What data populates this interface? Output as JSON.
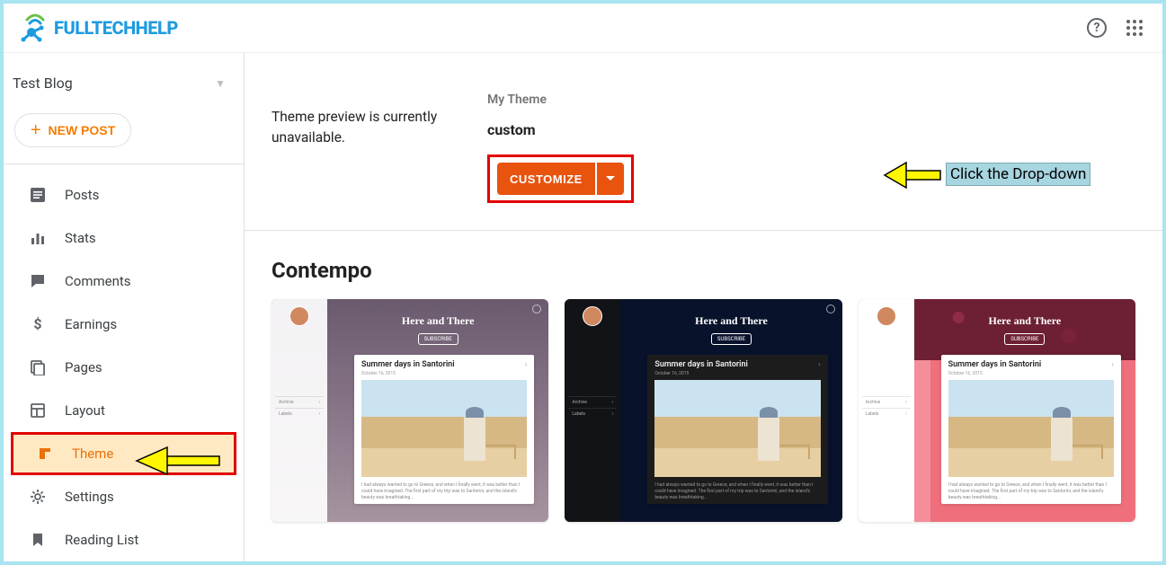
{
  "logo_text": "FULLTECHHELP",
  "blog_name": "Test Blog",
  "new_post_label": "NEW POST",
  "sidebar": {
    "items": [
      {
        "label": "Posts"
      },
      {
        "label": "Stats"
      },
      {
        "label": "Comments"
      },
      {
        "label": "Earnings"
      },
      {
        "label": "Pages"
      },
      {
        "label": "Layout"
      },
      {
        "label": "Theme"
      },
      {
        "label": "Settings"
      },
      {
        "label": "Reading List"
      }
    ]
  },
  "preview_message": "Theme preview is currently unavailable.",
  "my_theme": {
    "label": "My Theme",
    "name": "custom",
    "customize_button": "CUSTOMIZE"
  },
  "annotation_text": "Click the Drop-down",
  "section_title": "Contempo",
  "card_preview": {
    "banner_title": "Here and There",
    "post_title": "Summer days in Santorini",
    "side_label1": "Archive",
    "side_label2": "Labels"
  }
}
